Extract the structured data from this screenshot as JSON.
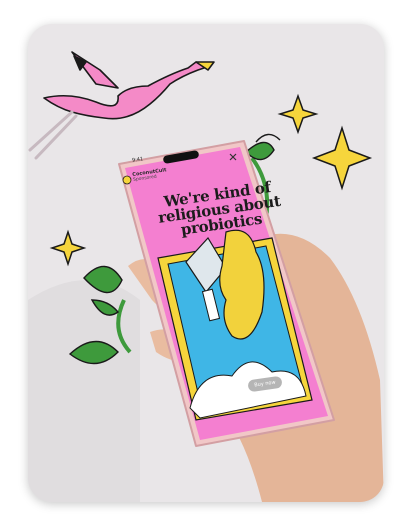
{
  "phone": {
    "status_time": "9:41",
    "brand_name": "CoconutCult",
    "brand_sub": "Sponsored",
    "headline": "We're kind of religious about probiotics",
    "cta_label": "Buy now"
  },
  "colors": {
    "card_bg": "#e9e6e8",
    "screen_pink": "#f47fd0",
    "flamingo": "#f48ac7",
    "leaf": "#3e9a3c",
    "star": "#f6d53c",
    "hand_yellow": "#f2d23c",
    "sky_blue": "#3fb6e6"
  }
}
